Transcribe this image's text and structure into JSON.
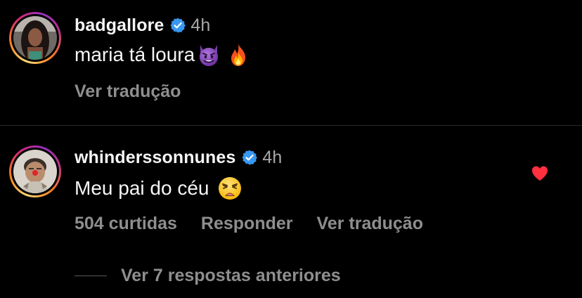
{
  "comments": [
    {
      "username": "badgallore",
      "verified": true,
      "time": "4h",
      "text": "maria tá loura",
      "emojis": [
        "smiling-imp-emoji",
        "fire-emoji"
      ],
      "actions": [
        "Ver tradução"
      ],
      "liked": false
    },
    {
      "username": "whinderssonnunes",
      "verified": true,
      "time": "4h",
      "text": "Meu pai do céu",
      "emojis": [
        "weary-face-emoji"
      ],
      "actions": [
        "504 curtidas",
        "Responder",
        "Ver tradução"
      ],
      "liked": true
    }
  ],
  "replies": {
    "label": "Ver 7 respostas anteriores"
  },
  "colors": {
    "background": "#000000",
    "verified_badge": "#3897f0",
    "like_heart": "#ff3040",
    "muted_text": "#8e8e8e"
  }
}
